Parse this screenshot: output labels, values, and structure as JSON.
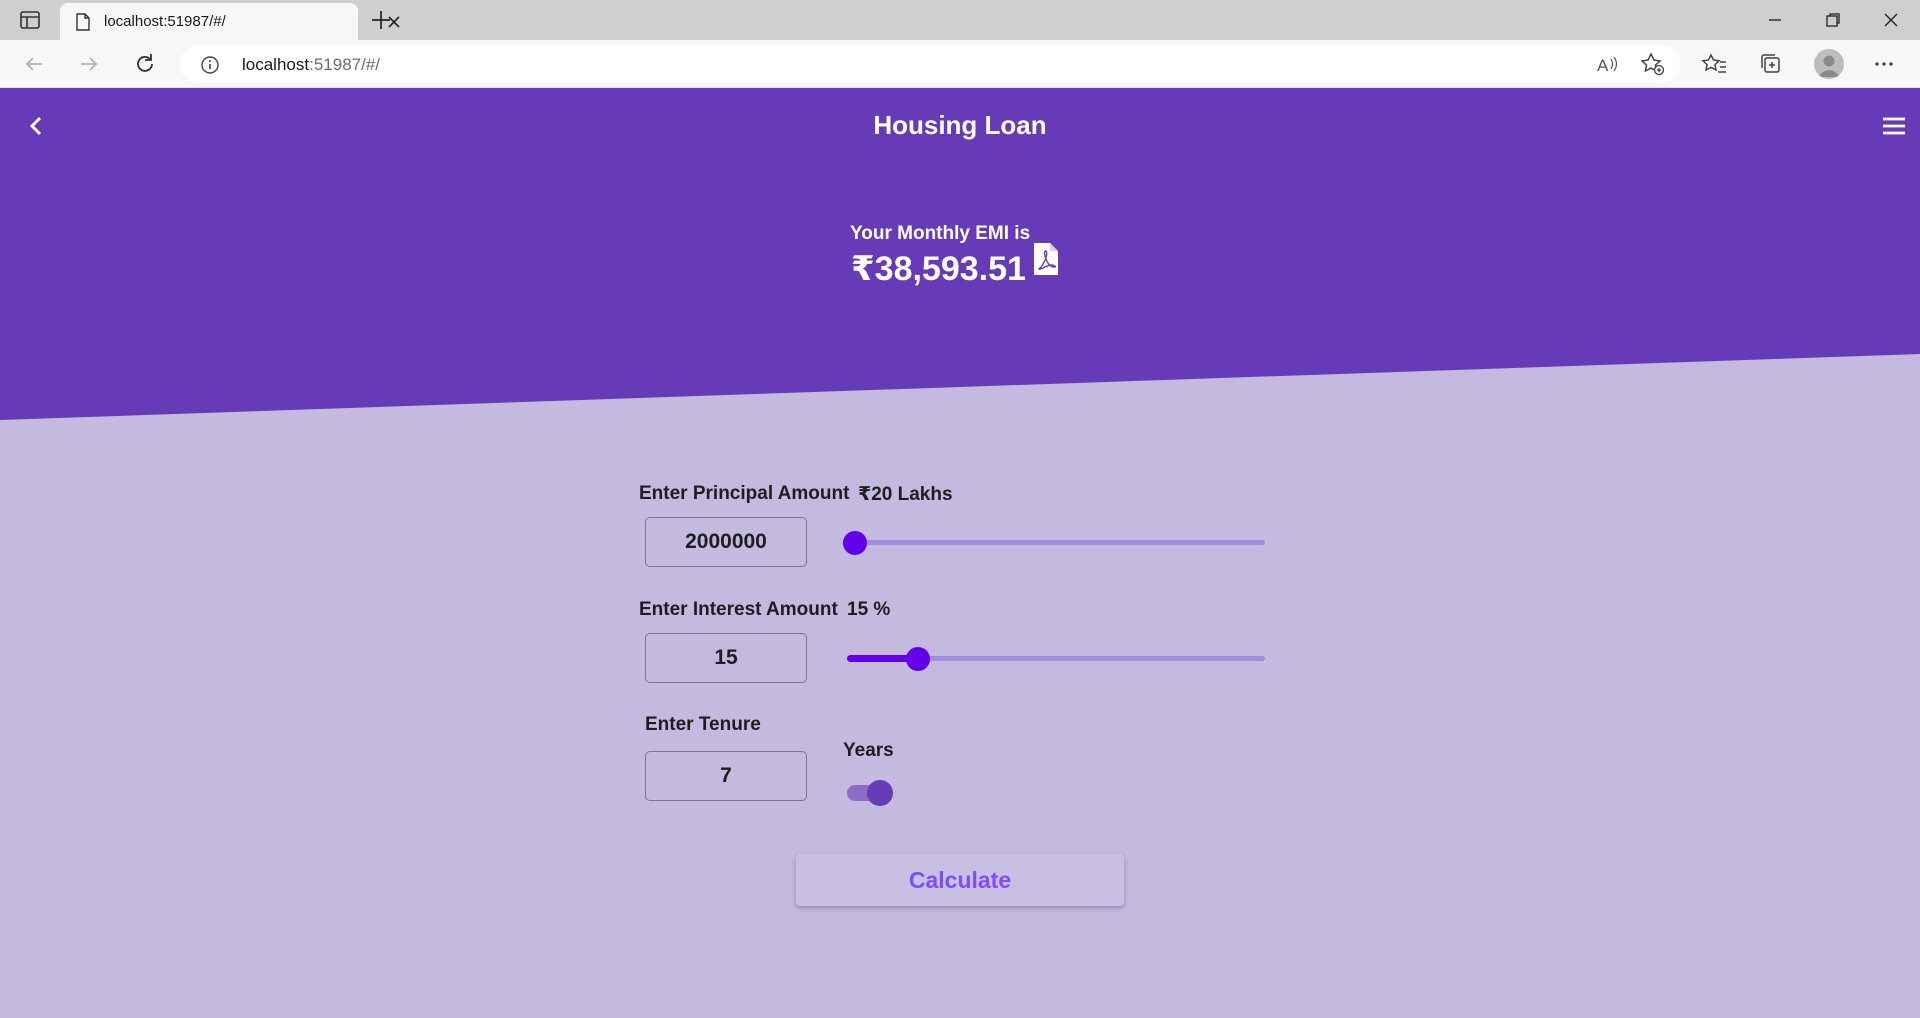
{
  "browser": {
    "tab_title": "localhost:51987/#/",
    "url_host": "localhost",
    "url_rest": ":51987/#/"
  },
  "app": {
    "title": "Housing Loan",
    "emi_label": "Your Monthly EMI is",
    "emi_value": "₹38,593.51",
    "colors": {
      "header": "#673ab7",
      "background": "#c4b9de",
      "slider_active": "#6200ea",
      "button_text": "#7c4dff"
    }
  },
  "form": {
    "principal": {
      "label": "Enter Principal Amount",
      "display": "₹20 Lakhs",
      "value": "2000000",
      "slider_fraction": 0.0
    },
    "interest": {
      "label": "Enter Interest Amount",
      "display": "15 %",
      "value": "15",
      "slider_fraction": 0.15
    },
    "tenure": {
      "label": "Enter Tenure",
      "value": "7",
      "unit_label": "Years",
      "toggle_on": true
    },
    "calculate_label": "Calculate"
  }
}
